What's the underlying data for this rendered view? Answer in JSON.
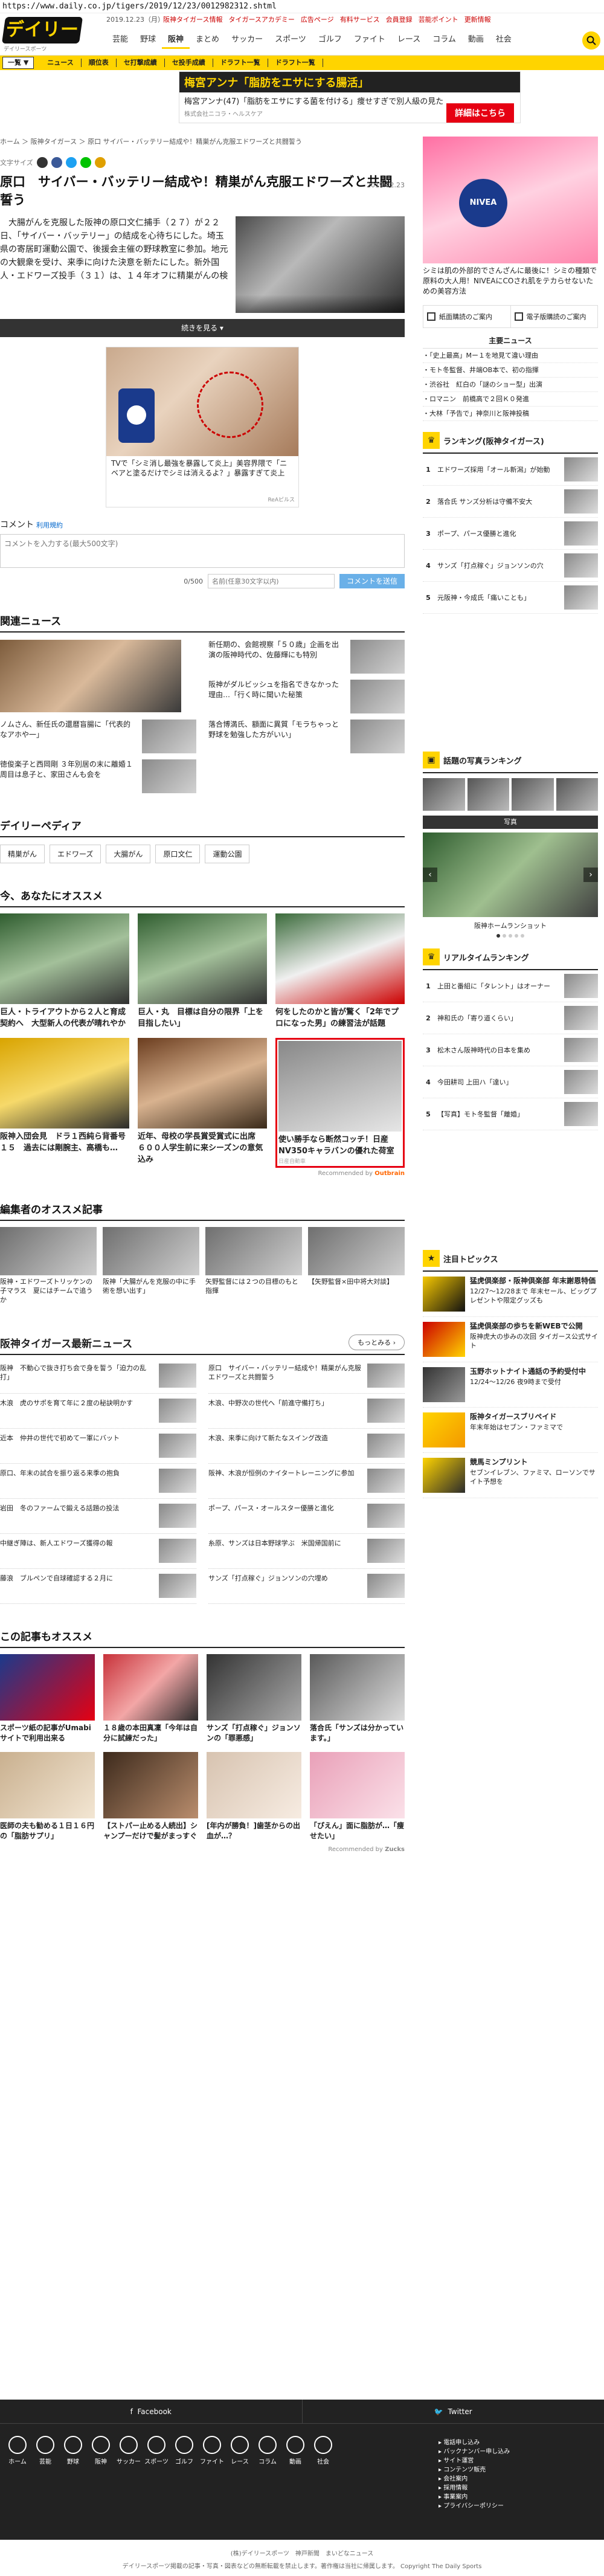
{
  "browser": {
    "url": "https://www.daily.co.jp/tigers/2019/12/23/0012982312.shtml"
  },
  "header": {
    "logo": "デイリー",
    "logo_tag": "デイリースポーツ",
    "date": "2019.12.23（月）",
    "links": [
      "阪神タイガース情報",
      "タイガースアカデミー",
      "広告ページ",
      "有料サービス",
      "会員登録",
      "芸能ポイント",
      "更新情報"
    ],
    "nav": [
      "芸能",
      "野球",
      "阪神",
      "まとめ",
      "サッカー",
      "スポーツ",
      "ゴルフ",
      "ファイト",
      "レース",
      "コラム",
      "動画",
      "社会"
    ],
    "nav_active": "阪神"
  },
  "subnav": {
    "first": "一覧 ▼",
    "items": [
      "ニュース",
      "順位表",
      "セ打撃成績",
      "セ投手成績",
      "ドラフト一覧",
      "ドラフト一覧"
    ]
  },
  "top_ad": {
    "title": "梅宮アンナ「脂肪をエサにする腸活」",
    "text": "梅宮アンナ(47)「脂肪をエサにする菌を付ける」痩せすぎで別人級の見た",
    "source": "株式会社ニコラ・ヘルスケア",
    "cta": "詳細はこちら"
  },
  "article": {
    "breadcrumb": "ホーム ＞ 阪神タイガース ＞ 原口 サイバー・バッテリー結成や！精巣がん克服エドワーズと共闘誓う",
    "tools_label": "文字サイズ",
    "date": "2019.12.23",
    "title": "原口　サイバー・バッテリー結成や！精巣がん克服エドワーズと共闘誓う",
    "lead": "　大腸がんを克服した阪神の原口文仁捕手（２７）が２２日、「サイバー・バッテリー」の結成を心待ちにした。埼玉県の寄居町運動公園で、後援会主催の野球教室に参加。地元の大観衆を受け、来季に向けた決意を新たにした。新外国人・エドワーズ投手（３１）は、１４年オフに精巣がんの検",
    "more": "続きを見る"
  },
  "inline_ad": {
    "text": "TVで「シミ消し最強を暴露して炎上」美容界隈で「ニベアと塗るだけでシミは消えるよ？」暴露すぎて炎上",
    "source": "ReAピルス"
  },
  "comment": {
    "label": "コメント",
    "terms": "利用規約",
    "placeholder": "コメントを入力する(最大500文字)",
    "count": "0/500",
    "name_placeholder": "名前(任意30文字以内)",
    "submit": "コメントを送信"
  },
  "related": {
    "title": "関連ニュース",
    "items": [
      "新任期の、会館視察「５０歳」企画を出演の阪神時代の、佐藤輝にも特別",
      "阪神がダルビッシュを指名できなかった理由…「行く時に聞いた秘策",
      "ノムさん、新任氏の還暦盲腸に「代表的なアホや一」",
      "落合博満氏、額面に異質「モラちゃっと野球を勉強した方がいい」",
      "徳俊楽子と西岡剛 ３年別居の末に離婚１周目は息子と、家田さんも会を"
    ]
  },
  "pedia": {
    "title": "デイリーペディア",
    "tags": [
      "精巣がん",
      "エドワーズ",
      "大腸がん",
      "原口文仁",
      "運動公園"
    ]
  },
  "osusume": {
    "title": "今、あなたにオススメ",
    "items": [
      "巨人・トライアウトから２人と育成契約へ　大型新人の代表が晴れやか",
      "巨人・丸　目標は自分の限界「上を目指したい」",
      "何をしたのかと皆が驚く「2年でプロになった男」の練習法が話題",
      "阪神入団会見　ドラ１西純ら背番号１５　過去には剛腕主、高橋も…",
      "近年、母校の学長賞受賞式に出席　６００人学生前に来シーズンの意気込み",
      "使い勝手なら断然コッチ！日産NV350キャラバンの優れた荷室"
    ],
    "ad_source": "日産自動車",
    "recommend_by": "Recommended by",
    "outbrain": "Outbrain"
  },
  "editor": {
    "title": "編集者のオススメ記事",
    "items": [
      "阪神・エドワーズトリッケンの子マラス　夏にはチームで追うか",
      "阪神「大腸がんを克服の中に手術を想い出す」",
      "矢野監督には２つの目標のもと指揮",
      "【矢野監督×田中将大対談】"
    ]
  },
  "latest": {
    "title": "阪神タイガース最新ニュース",
    "more": "もっとみる",
    "items": [
      "阪神　不動心で抜き打ち会で身を誓う「迫力の乱打」",
      "原口　サイバー・バッテリー結成や！精巣がん克服エドワーズと共闘誓う",
      "木浪　虎のサポを育て年に２度の秘訣明かす",
      "木浪、中野次の世代へ「前進守備打ち」",
      "近本　仲井の世代で初めて一軍にバット",
      "木浪、来季に向けて新たなスイング改造",
      "原口、年末の試合を振り返る来季の抱負",
      "阪神、木浪が恒例のナイタートレーニングに参加",
      "岩田　冬のファームで鍛える話題の投法",
      "ポープ、パース・オールスター優勝と進化",
      "中継ぎ陣は、新人エドワーズ獲得の報",
      "糸原、サンズは日本野球学ぶ　米国帰国前に",
      "藤浪　ブルペンで自球確認する２月に",
      "サンズ「打点稼ぐ」ジョンソンの穴埋め"
    ]
  },
  "kono": {
    "title": "この記事もオススメ",
    "items": [
      "スポーツ紙の記事がUmabiサイトで利用出来る",
      "１８歳の本田真凜「今年は自分に試練だった」",
      "サンズ「打点稼ぐ」ジョンソンの「罪悪感」",
      "落合氏「サンズは分かっています。」",
      "医師の夫も勧める１日１６円の「脂肪サプリ」",
      "【ストパー止める人続出】シャンプーだけで髪がまっすぐ",
      "[年内が勝負！]歯茎からの出血が…？",
      "「ぴえん」面に脂肪が…「痩せたい」"
    ],
    "recommend_by": "Recommended by",
    "zucks": "Zucks"
  },
  "sidebar": {
    "ad_text": "シミは肌の外部的でさんざんに最後に！シミの種類で原料の大人用！NIVEAにCOされ肌をテカらせないための美容方法",
    "links": [
      "紙面購読のご案内",
      "電子版購読のご案内"
    ],
    "main_news_title": "主要ニュース",
    "main_news": [
      "「史上最高」Mー１を地見て違い理由",
      "モト冬監督、井端OB本で、初の指揮",
      "渋谷社　紅白の「謎のショー型」出演",
      "ロマニン　前橋高で２回Ｋ０発進",
      "大林「予告で」神奈川と阪神投稿"
    ],
    "rank_title": "ランキング(阪神タイガース)",
    "rank": [
      "エドワーズ採用「オール新潟」が始動",
      "落合氏 サンズ分析は守備不安大",
      "ポープ、パース優勝と進化",
      "サンズ「打点稼ぐ」ジョンソンの穴",
      "元阪神・今成氏「痛いことも」"
    ],
    "photo_rank_title": "話題の写真ランキング",
    "photo_header": "写真",
    "photo_caption": "阪神ホームランショット",
    "realtime_title": "リアルタイムランキング",
    "realtime": [
      "上田と番組に「タレント」はオーナー",
      "神和氏の「寄り道くらい」",
      "松木さん阪神時代の日本を集め",
      "今田耕司 上田ハ「達い」",
      "【写真】モト冬監督「離婚」"
    ],
    "topics_title": "注目トピックス",
    "topics": [
      {
        "title": "猛虎倶楽部・阪神倶楽部 年末謝恩特価",
        "text": "12/27〜12/28まで 年末セール、ビッグプレゼントや限定グッズも"
      },
      {
        "title": "猛虎倶楽部の歩ちを新WEBで公開",
        "text": "阪神虎大の歩みの次回 タイガース公式サイト"
      },
      {
        "title": "玉野ホットナイト通話の予約受付中",
        "text": "12/24〜12/26 夜9時まで受付"
      },
      {
        "title": "阪神タイガースブリペイド",
        "text": "年末年始はセブン・ファミマで"
      },
      {
        "title": "競馬ミンプリント",
        "text": "セブンイレブン、ファミマ、ローソンでサイト予想を"
      }
    ]
  },
  "footer": {
    "facebook": "Facebook",
    "twitter": "Twitter",
    "nav": [
      "ホーム",
      "芸能",
      "野球",
      "阪神",
      "サッカー",
      "スポーツ",
      "ゴルフ",
      "ファイト",
      "レース",
      "コラム",
      "動画",
      "社会"
    ],
    "links": [
      "電話申し込み",
      "バックナンバー申し込み",
      "サイト運営",
      "コンテンツ販売",
      "会社案内",
      "採用情報",
      "事業案内",
      "プライバシーポリシー"
    ],
    "corp": "(株)デイリースポーツ　神戸新聞　まいどなニュース",
    "copyright": "デイリースポーツ掲載の記事・写真・図表などの無断転載を禁止します。著作権は当社に帰属します。 Copyright The Daily Sports"
  }
}
